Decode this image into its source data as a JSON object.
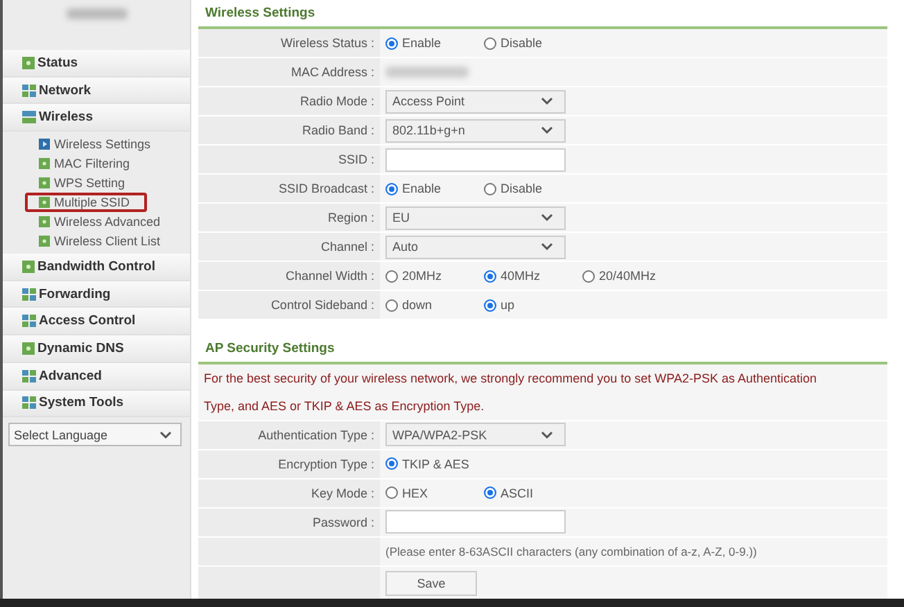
{
  "sidebar": {
    "items": [
      {
        "label": "Status",
        "kind": "page"
      },
      {
        "label": "Network",
        "kind": "folder",
        "expanded": false
      },
      {
        "label": "Wireless",
        "kind": "folder",
        "expanded": true,
        "children": [
          {
            "label": "Wireless Settings",
            "selected": true,
            "highlighted": false
          },
          {
            "label": "MAC Filtering",
            "selected": false,
            "highlighted": false
          },
          {
            "label": "WPS Setting",
            "selected": false,
            "highlighted": false
          },
          {
            "label": "Multiple SSID",
            "selected": false,
            "highlighted": true
          },
          {
            "label": "Wireless Advanced",
            "selected": false,
            "highlighted": false
          },
          {
            "label": "Wireless Client List",
            "selected": false,
            "highlighted": false
          }
        ]
      },
      {
        "label": "Bandwidth Control",
        "kind": "page"
      },
      {
        "label": "Forwarding",
        "kind": "folder",
        "expanded": false
      },
      {
        "label": "Access Control",
        "kind": "folder",
        "expanded": false
      },
      {
        "label": "Dynamic DNS",
        "kind": "page"
      },
      {
        "label": "Advanced",
        "kind": "folder",
        "expanded": false
      },
      {
        "label": "System Tools",
        "kind": "folder",
        "expanded": false
      }
    ],
    "language": {
      "value": "Select Language"
    }
  },
  "sections": [
    {
      "title": "Wireless Settings",
      "rows": [
        {
          "label": "Wireless Status :",
          "kind": "radio",
          "options": [
            {
              "label": "Enable",
              "selected": true
            },
            {
              "label": "Disable",
              "selected": false
            }
          ]
        },
        {
          "label": "MAC Address :",
          "kind": "redacted"
        },
        {
          "label": "Radio Mode :",
          "kind": "select",
          "value": "Access Point"
        },
        {
          "label": "Radio Band :",
          "kind": "select",
          "value": "802.11b+g+n"
        },
        {
          "label": "SSID :",
          "kind": "input"
        },
        {
          "label": "SSID Broadcast :",
          "kind": "radio",
          "options": [
            {
              "label": "Enable",
              "selected": true
            },
            {
              "label": "Disable",
              "selected": false
            }
          ]
        },
        {
          "label": "Region :",
          "kind": "select",
          "value": "EU"
        },
        {
          "label": "Channel :",
          "kind": "select",
          "value": "Auto"
        },
        {
          "label": "Channel Width :",
          "kind": "radio",
          "options": [
            {
              "label": "20MHz",
              "selected": false
            },
            {
              "label": "40MHz",
              "selected": true
            },
            {
              "label": "20/40MHz",
              "selected": false
            }
          ]
        },
        {
          "label": "Control Sideband :",
          "kind": "radio",
          "options": [
            {
              "label": "down",
              "selected": false
            },
            {
              "label": "up",
              "selected": true
            }
          ]
        }
      ]
    },
    {
      "title": "AP Security Settings",
      "notice": "For the best security of your wireless network, we strongly recommend you to set WPA2-PSK as Authentication Type, and AES or TKIP & AES as Encryption Type.",
      "rows": [
        {
          "label": "Authentication Type :",
          "kind": "select",
          "value": "WPA/WPA2-PSK"
        },
        {
          "label": "Encryption Type :",
          "kind": "radio",
          "options": [
            {
              "label": "TKIP & AES",
              "selected": true
            }
          ]
        },
        {
          "label": "Key Mode :",
          "kind": "radio",
          "options": [
            {
              "label": "HEX",
              "selected": false
            },
            {
              "label": "ASCII",
              "selected": true
            }
          ]
        },
        {
          "label": "Password :",
          "kind": "input"
        },
        {
          "kind": "hint",
          "text": "(Please enter 8-63ASCII characters (any combination of a-z, A-Z, 0-9.))"
        },
        {
          "kind": "button",
          "text": "Save"
        }
      ]
    }
  ]
}
